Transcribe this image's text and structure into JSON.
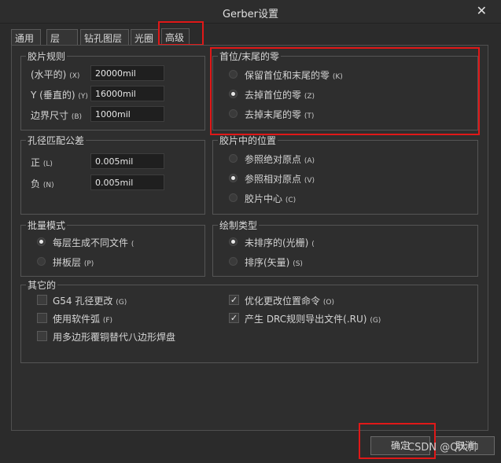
{
  "window": {
    "title": "Gerber设置",
    "close_glyph": "✕"
  },
  "tabs": [
    {
      "label": "通用"
    },
    {
      "label": "层"
    },
    {
      "label": "钻孔图层"
    },
    {
      "label": "光圈"
    },
    {
      "label": "高级"
    }
  ],
  "film_rules": {
    "title": "胶片规则",
    "rows": [
      {
        "label": "(水平的)",
        "hotkey": "(X)",
        "value": "20000mil"
      },
      {
        "label": "Y (垂直的)",
        "hotkey": "(Y)",
        "value": "16000mil"
      },
      {
        "label": "边界尺寸",
        "hotkey": "(B)",
        "value": "1000mil"
      }
    ]
  },
  "leading_trailing_zeros": {
    "title": "首位/末尾的零",
    "options": [
      {
        "label": "保留首位和末尾的零",
        "hotkey": "(K)",
        "selected": false
      },
      {
        "label": "去掉首位的零",
        "hotkey": "(Z)",
        "selected": true
      },
      {
        "label": "去掉末尾的零",
        "hotkey": "(T)",
        "selected": false
      }
    ]
  },
  "aperture_tolerance": {
    "title": "孔径匹配公差",
    "rows": [
      {
        "label": "正",
        "hotkey": "(L)",
        "value": "0.005mil"
      },
      {
        "label": "负",
        "hotkey": "(N)",
        "value": "0.005mil"
      }
    ]
  },
  "film_position": {
    "title": "胶片中的位置",
    "options": [
      {
        "label": "参照绝对原点",
        "hotkey": "(A)",
        "selected": false
      },
      {
        "label": "参照相对原点",
        "hotkey": "(V)",
        "selected": true
      },
      {
        "label": "胶片中心",
        "hotkey": "(C)",
        "selected": false
      }
    ]
  },
  "batch_mode": {
    "title": "批量模式",
    "options": [
      {
        "label": "每层生成不同文件",
        "hotkey": "(",
        "selected": true
      },
      {
        "label": "拼板层",
        "hotkey": "(P)",
        "selected": false
      }
    ]
  },
  "plot_type": {
    "title": "绘制类型",
    "options": [
      {
        "label": "未排序的(光栅)",
        "hotkey": "(",
        "selected": true
      },
      {
        "label": "排序(矢量)",
        "hotkey": "(S)",
        "selected": false
      }
    ]
  },
  "other": {
    "title": "其它的",
    "left": [
      {
        "label": "G54 孔径更改",
        "hotkey": "(G)",
        "checked": false
      },
      {
        "label": "使用软件弧",
        "hotkey": "(F)",
        "checked": false
      },
      {
        "label": "用多边形覆铜替代八边形焊盘",
        "hotkey": "",
        "checked": false
      }
    ],
    "right": [
      {
        "label": "优化更改位置命令",
        "hotkey": "(O)",
        "checked": true
      },
      {
        "label": "产生 DRC规则导出文件(.RU)",
        "hotkey": "(G)",
        "checked": true
      }
    ]
  },
  "buttons": {
    "ok": "确定",
    "cancel": "取消"
  },
  "watermark": "CSDN @Q大帅"
}
